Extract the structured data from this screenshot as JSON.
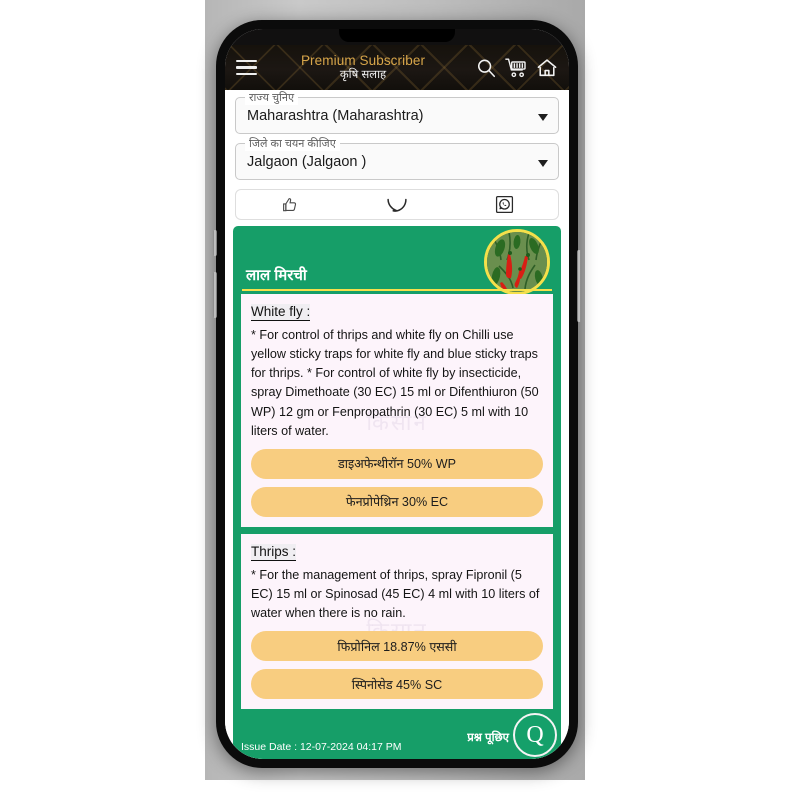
{
  "header": {
    "menu_icon": "hamburger-menu-icon",
    "title_primary": "Premium Subscriber",
    "title_secondary": "कृषि सलाह",
    "icons": [
      "search-icon",
      "cart-icon",
      "home-icon"
    ]
  },
  "filters": {
    "state": {
      "label": "राज्य चुनिए",
      "value": "Maharashtra (Maharashtra)"
    },
    "district": {
      "label": "जिले का चयन कीजिए",
      "value": "Jalgaon (Jalgaon )"
    }
  },
  "actions": [
    {
      "name": "like-icon",
      "glyph": "thumbs-up"
    },
    {
      "name": "comment-icon",
      "glyph": "speech-bubble"
    },
    {
      "name": "whatsapp-share-icon",
      "glyph": "whatsapp"
    }
  ],
  "advisory": {
    "crop_title": "लाल मिरची",
    "crop_image": "red-chilli-plant-photo",
    "watermark": "किसान",
    "sections": [
      {
        "title": "White fly :",
        "text": "* For control of thrips and white fly on Chilli use yellow sticky traps for white fly and blue sticky traps for thrips.\n* For control of white fly by insecticide, spray Dimethoate (30 EC) 15 ml or Difenthiuron (50 WP) 12 gm or Fenpropathrin (30 EC) 5 ml with 10 liters of water.",
        "products": [
          "डाइअफेन्थीरॉन 50% WP",
          "फेनप्रोपेथ्रिन 30% EC"
        ]
      },
      {
        "title": "Thrips :",
        "text": "* For the management of thrips, spray Fipronil (5 EC) 15 ml or Spinosad (45 EC) 4 ml with 10 liters of water when there is no rain.",
        "products": [
          "फिप्रोनिल 18.87% एससी",
          "स्पिनोसेड 45% SC"
        ]
      }
    ]
  },
  "footer": {
    "issue_date": "Issue Date : 12-07-2024 04:17 PM",
    "ask_label": "प्रश्न पूछिए",
    "fab_letter": "Q"
  },
  "colors": {
    "brand_gold": "#d8a64a",
    "card_green": "#169e68",
    "pill_amber": "#f8cd80",
    "accent_yellow": "#f5e04b",
    "panel_bg": "#fdf4fb"
  }
}
